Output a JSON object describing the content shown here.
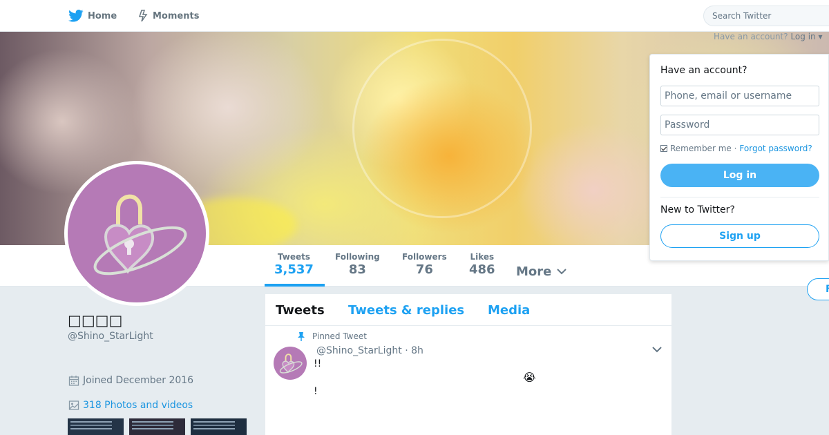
{
  "nav": {
    "home_label": "Home",
    "moments_label": "Moments",
    "search_placeholder": "Search Twitter",
    "login_hint_prefix": "Have an account?",
    "login_hint_link": "Log in ▾"
  },
  "profile": {
    "name": "□□□□",
    "handle": "@Shino_StarLight",
    "joined": "Joined December 2016",
    "photos_label": "318 Photos and videos"
  },
  "stats": [
    {
      "label": "Tweets",
      "value": "3,537"
    },
    {
      "label": "Following",
      "value": "83"
    },
    {
      "label": "Followers",
      "value": "76"
    },
    {
      "label": "Likes",
      "value": "486"
    }
  ],
  "more_label": "More",
  "follow_stub_label": "F",
  "timeline": {
    "tabs": [
      "Tweets",
      "Tweets & replies",
      "Media"
    ],
    "pinned_label": "Pinned Tweet",
    "tweet": {
      "header": "@Shino_StarLight · 8h",
      "line1": "!!",
      "emoji": "😭",
      "line2": "!"
    }
  },
  "login_panel": {
    "title": "Have an account?",
    "username_placeholder": "Phone, email or username",
    "password_placeholder": "Password",
    "remember_label": "Remember me ·",
    "forgot_label": "Forgot password?",
    "login_button": "Log in",
    "new_label": "New to Twitter?",
    "signup_button": "Sign up"
  },
  "colors": {
    "accent": "#1da1f2",
    "avatar_bg": "#b57ab6",
    "page_bg": "#e6ecf0"
  }
}
